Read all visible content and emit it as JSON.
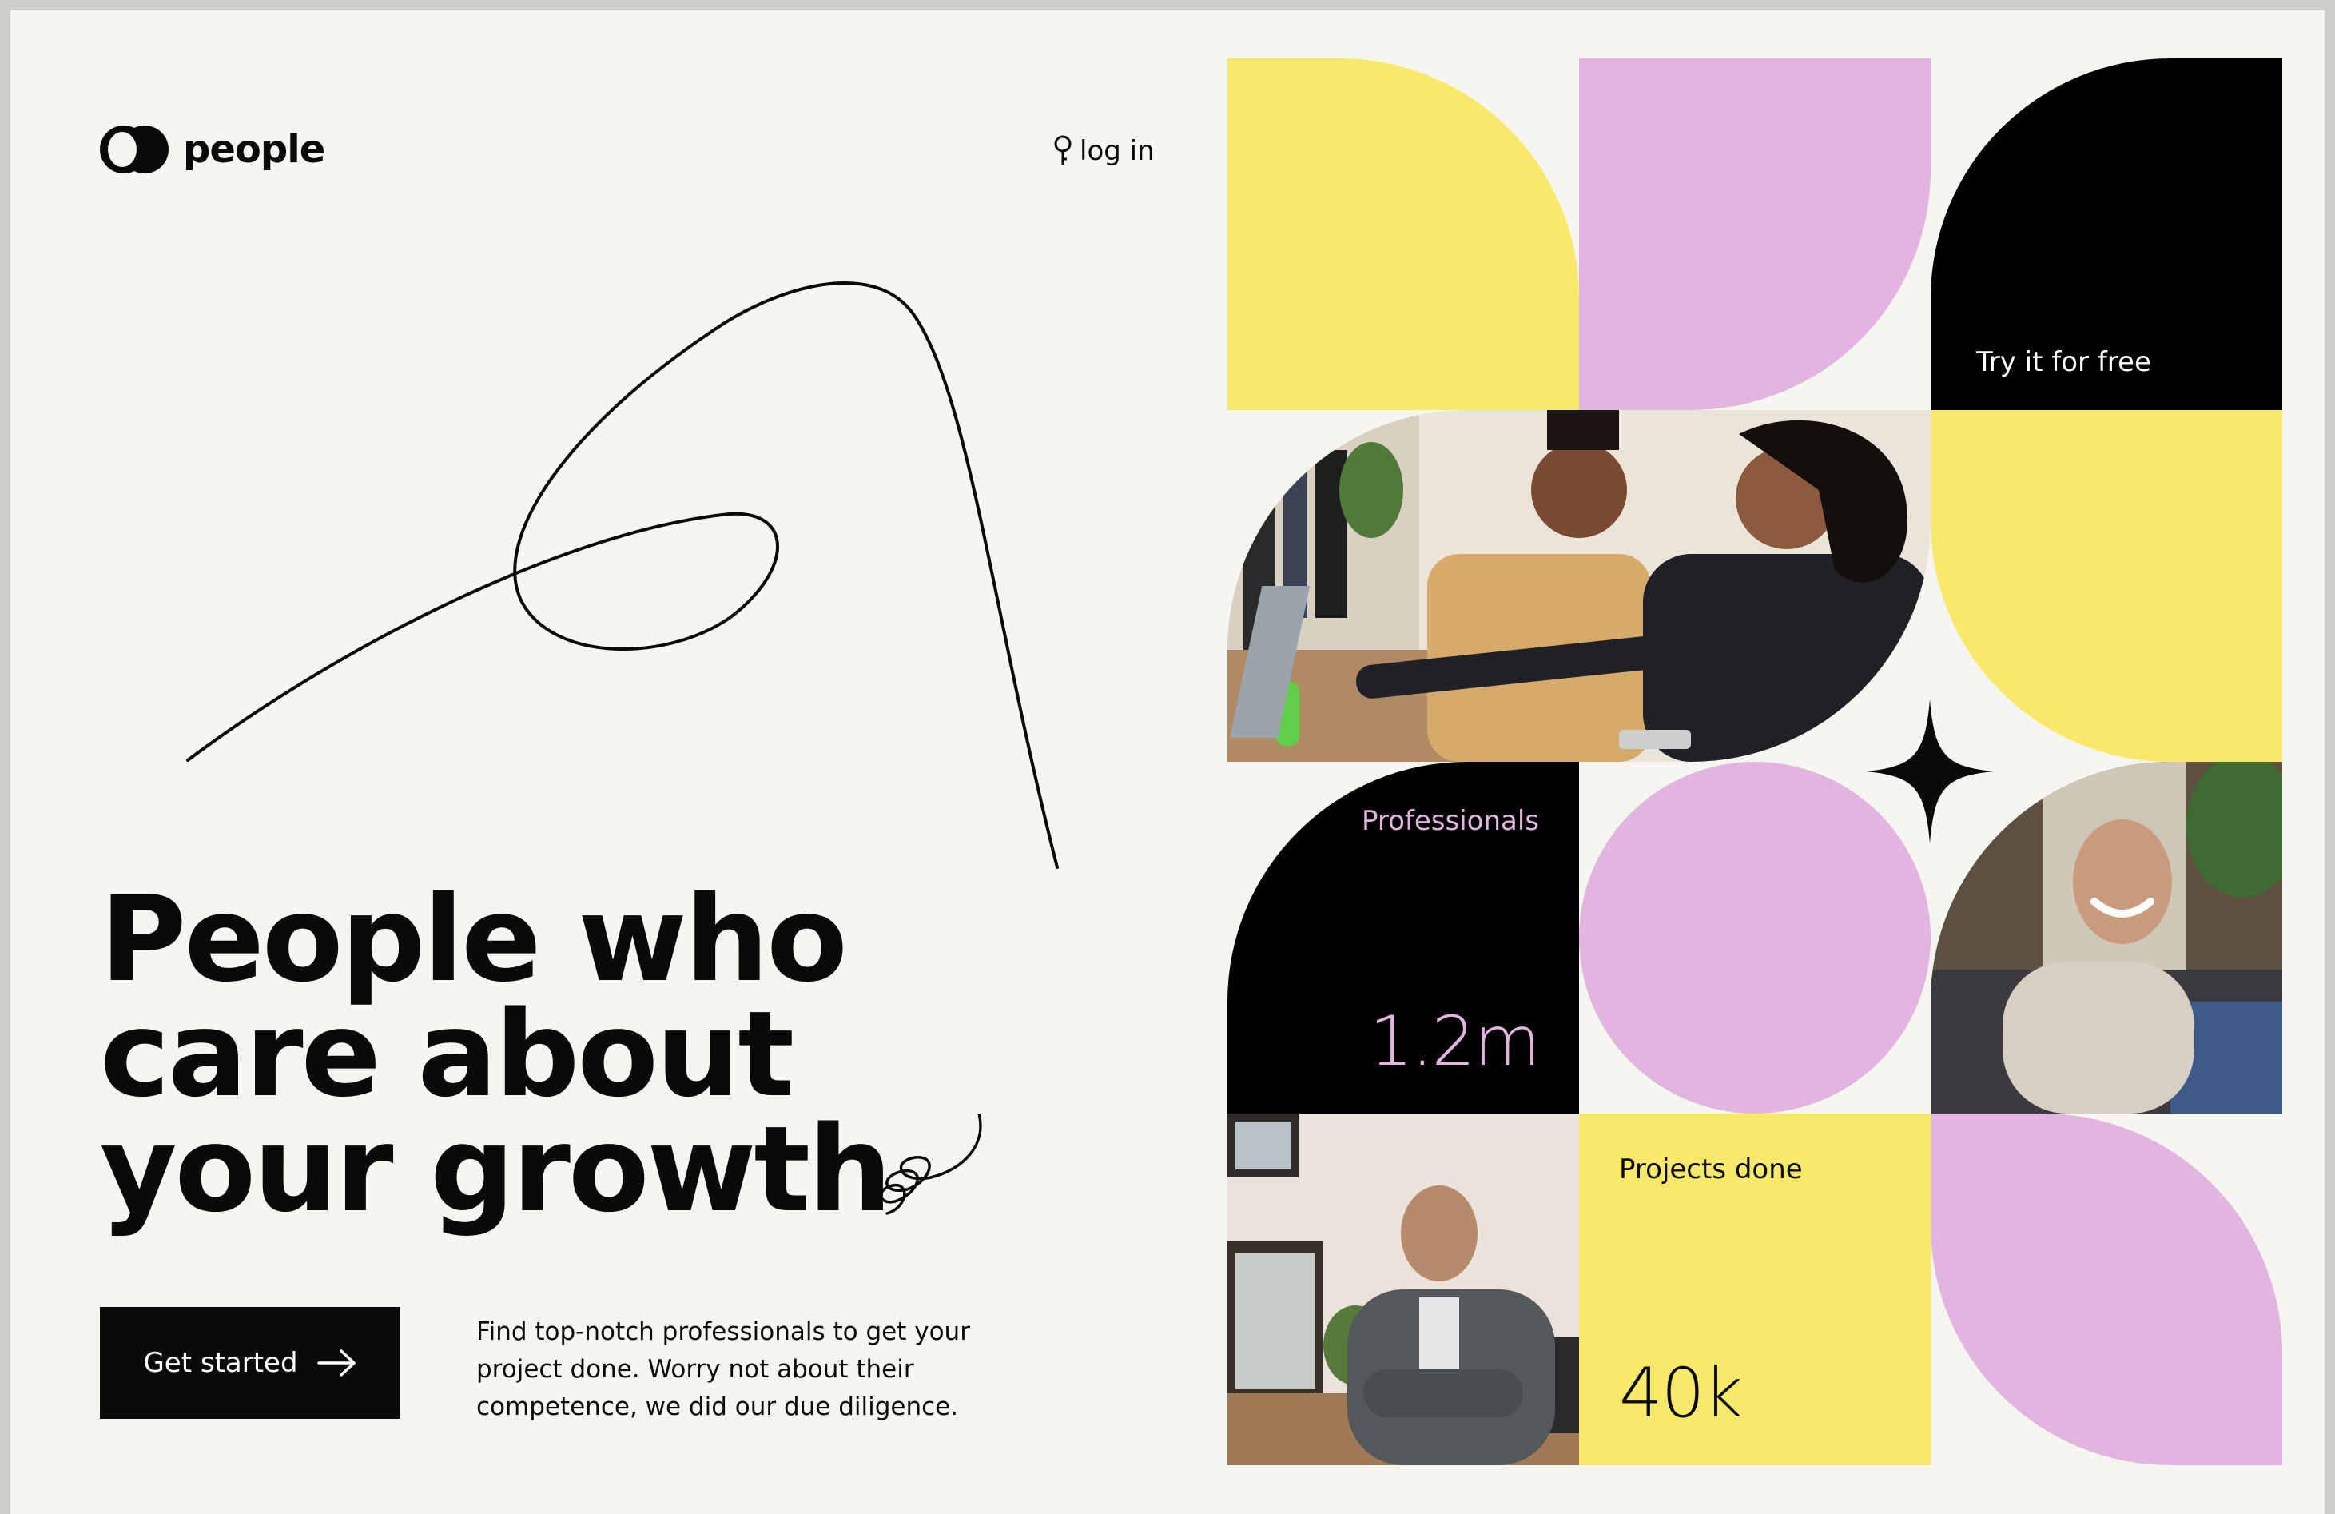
{
  "brand": {
    "name": "people"
  },
  "header": {
    "login_label": "log in"
  },
  "hero": {
    "title_lines": [
      "People who",
      "care about",
      "your growth"
    ],
    "cta_label": "Get started",
    "description": "Find top-notch professionals to get your project done. Worry not about their competence, we did our due diligence."
  },
  "grid": {
    "try_free_label": "Try it for free",
    "stats": [
      {
        "label": "Professionals",
        "value": "1.2m"
      },
      {
        "label": "Projects done",
        "value": "40k"
      }
    ]
  },
  "colors": {
    "background": "#f6f5f0",
    "yellow": "#f8e96a",
    "pink": "#e1b5e0",
    "black": "#000000",
    "stat_value_pink": "#e1b5e0"
  },
  "icons": [
    "logo-mark-icon",
    "key-icon",
    "arrow-right-icon",
    "four-point-star-icon",
    "spiral-doodle-icon"
  ]
}
